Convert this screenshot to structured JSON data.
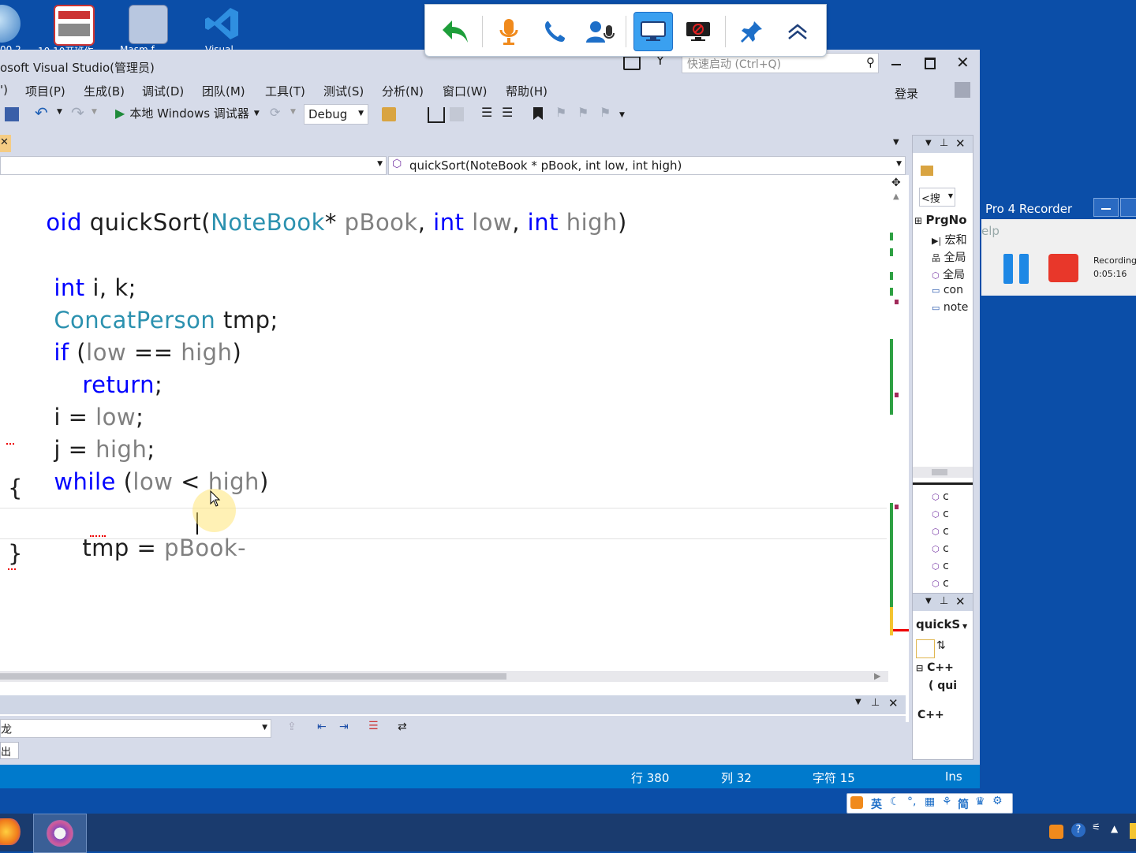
{
  "desktop": {
    "icons": [
      {
        "label": "00.2"
      },
      {
        "label": "10.10开班作"
      },
      {
        "label": "Masm f"
      },
      {
        "label": "Visual"
      }
    ]
  },
  "remote_toolbar": {
    "buttons": [
      "back-arrow-icon",
      "microphone-icon",
      "phone-icon",
      "voice-user-icon",
      "screen-share-icon",
      "stop-share-icon",
      "pin-icon",
      "collapse-up-icon"
    ]
  },
  "window": {
    "title": "osoft Visual Studio(管理员)",
    "quick_launch_placeholder": "快速启动 (Ctrl+Q)",
    "sign_in": "登录"
  },
  "menu": [
    {
      "label": "')"
    },
    {
      "label": "项目(P)"
    },
    {
      "label": "生成(B)"
    },
    {
      "label": "调试(D)"
    },
    {
      "label": "团队(M)"
    },
    {
      "label": "工具(T)"
    },
    {
      "label": "测试(S)"
    },
    {
      "label": "分析(N)"
    },
    {
      "label": "窗口(W)"
    },
    {
      "label": "帮助(H)"
    }
  ],
  "toolbar": {
    "run_label": "本地 Windows 调试器",
    "config": "Debug"
  },
  "navbar": {
    "member": "quickSort(NoteBook * pBook, int low, int high)"
  },
  "code": {
    "l1_void": "oid",
    "l1_name": " quickSort(",
    "l1_type": "NoteBook",
    "l1_star": "* ",
    "l1_p1": "pBook",
    "l1_c1": ", ",
    "l1_int1": "int",
    "l1_sp1": " ",
    "l1_p2": "low",
    "l1_c2": ", ",
    "l1_int2": "int",
    "l1_sp2": " ",
    "l1_p3": "high",
    "l1_close": ")",
    "l3_int": "int",
    "l3_rest": " i, k;",
    "l4_type": "ConcatPerson",
    "l4_rest": " tmp;",
    "l5_if": "if",
    "l5_a": " (",
    "l5_low": "low",
    "l5_op": " == ",
    "l5_high": "high",
    "l5_b": ")",
    "l6_return": "return",
    "l6_semi": ";",
    "l7_i": "i = ",
    "l7_low": "low",
    "l7_semi": ";",
    "l8_j": "j = ",
    "l8_high": "high",
    "l8_semi": ";",
    "l9_while": "while",
    "l9_a": " (",
    "l9_low": "low",
    "l9_op": " < ",
    "l9_high": "high",
    "l9_b": ")",
    "l10": "{",
    "l11_tmp": "tmp = ",
    "l11_pbook": "pBook-",
    "l12": "}"
  },
  "recorder": {
    "title": "Pro 4 Recorder",
    "menu": "elp",
    "recording_label": "Recording:",
    "time": "0:05:16"
  },
  "class_view": {
    "search": "<搜",
    "root": "PrgNo",
    "items": [
      "宏和",
      "全局",
      "全局",
      "con",
      "note"
    ],
    "members": [
      "c",
      "c",
      "c",
      "c",
      "c",
      "c"
    ]
  },
  "properties": {
    "object": "quickS",
    "group": "C++",
    "row": "( qui",
    "footer": "C++"
  },
  "output": {
    "source_prefix": "龙",
    "tab_label": "出"
  },
  "status": {
    "line": "行 380",
    "col": "列 32",
    "ch": "字符 15",
    "ins": "Ins"
  },
  "ime": {
    "lang": "英",
    "simp": "简"
  },
  "colors": {
    "status_bar": "#007acc",
    "keyword": "#0000ff",
    "type": "#2b91af",
    "param": "#808080",
    "record_stop": "#e8372a",
    "pause": "#1e88e5"
  }
}
